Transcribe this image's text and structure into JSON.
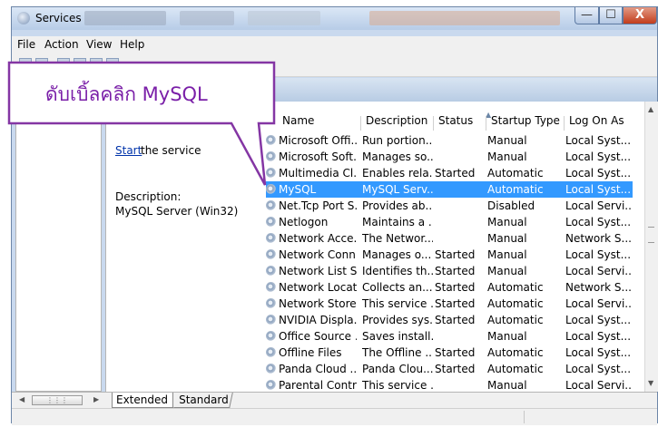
{
  "window": {
    "title": "Services",
    "controls": {
      "minimize": "—",
      "maximize": "☐",
      "close": "X"
    }
  },
  "menu": [
    "File",
    "Action",
    "View",
    "Help"
  ],
  "left_pane": {
    "start_link": "Start",
    "start_rest": " the service",
    "description_label": "Description:",
    "description_value": "MySQL Server (Win32)"
  },
  "columns": [
    "Name",
    "Description",
    "Status",
    "Startup Type",
    "Log On As"
  ],
  "rows": [
    {
      "name": "Microsoft Offi...",
      "description": "Run portion...",
      "status": "",
      "startup": "Manual",
      "logon": "Local Syst..."
    },
    {
      "name": "Microsoft Soft...",
      "description": "Manages so...",
      "status": "",
      "startup": "Manual",
      "logon": "Local Syst..."
    },
    {
      "name": "Multimedia Cl...",
      "description": "Enables rela...",
      "status": "Started",
      "startup": "Automatic",
      "logon": "Local Syst..."
    },
    {
      "name": "MySQL",
      "description": "MySQL Serv...",
      "status": "",
      "startup": "Automatic",
      "logon": "Local Syst..."
    },
    {
      "name": "Net.Tcp Port S...",
      "description": "Provides ab...",
      "status": "",
      "startup": "Disabled",
      "logon": "Local Servi..."
    },
    {
      "name": "Netlogon",
      "description": "Maintains a ...",
      "status": "",
      "startup": "Manual",
      "logon": "Local Syst..."
    },
    {
      "name": "Network Acce...",
      "description": "The Networ...",
      "status": "",
      "startup": "Manual",
      "logon": "Network S..."
    },
    {
      "name": "Network Conn...",
      "description": "Manages o...",
      "status": "Started",
      "startup": "Manual",
      "logon": "Local Syst..."
    },
    {
      "name": "Network List S...",
      "description": "Identifies th...",
      "status": "Started",
      "startup": "Manual",
      "logon": "Local Servi..."
    },
    {
      "name": "Network Locat...",
      "description": "Collects an...",
      "status": "Started",
      "startup": "Automatic",
      "logon": "Network S..."
    },
    {
      "name": "Network Store...",
      "description": "This service ...",
      "status": "Started",
      "startup": "Automatic",
      "logon": "Local Servi..."
    },
    {
      "name": "NVIDIA Displa...",
      "description": "Provides sys...",
      "status": "Started",
      "startup": "Automatic",
      "logon": "Local Syst..."
    },
    {
      "name": "Office Source ...",
      "description": "Saves install...",
      "status": "",
      "startup": "Manual",
      "logon": "Local Syst..."
    },
    {
      "name": "Offline Files",
      "description": "The Offline ...",
      "status": "Started",
      "startup": "Automatic",
      "logon": "Local Syst..."
    },
    {
      "name": "Panda Cloud ...",
      "description": "Panda Clou...",
      "status": "Started",
      "startup": "Automatic",
      "logon": "Local Syst..."
    },
    {
      "name": "Parental Contr...",
      "description": "This service ...",
      "status": "",
      "startup": "Manual",
      "logon": "Local Servi..."
    }
  ],
  "selected_row": "MySQL",
  "tabs": {
    "extended": "Extended",
    "standard": "Standard"
  },
  "callout": {
    "text": "ดับเบิ้ลคลิก MySQL",
    "color": "#7a1fa8"
  },
  "colors": {
    "selection": "#3399ff",
    "link": "#0033aa"
  }
}
